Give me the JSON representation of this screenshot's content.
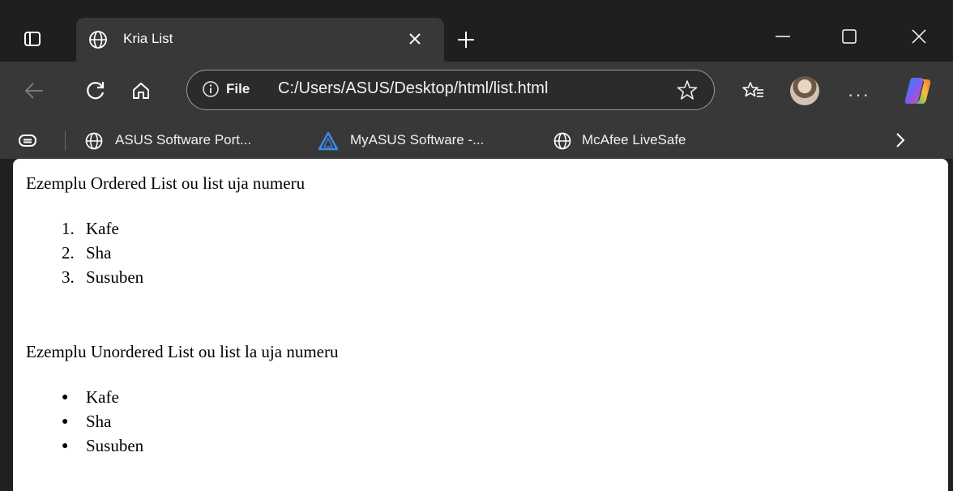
{
  "tab": {
    "title": "Kria List"
  },
  "omnibox": {
    "scheme": "File",
    "url": "C:/Users/ASUS/Desktop/html/list.html"
  },
  "favorites": [
    {
      "label": "ASUS Software Port...",
      "icon": "globe-icon"
    },
    {
      "label": "MyASUS Software -...",
      "icon": "myasus-logo-icon"
    },
    {
      "label": "McAfee LiveSafe",
      "icon": "globe-icon"
    }
  ],
  "page": {
    "ordered_heading": "Ezemplu Ordered List ou list uja numeru",
    "ordered_items": [
      {
        "marker": "1.",
        "text": "Kafe"
      },
      {
        "marker": "2.",
        "text": "Sha"
      },
      {
        "marker": "3.",
        "text": "Susuben"
      }
    ],
    "unordered_heading": "Ezemplu Unordered List ou list la uja numeru",
    "unordered_items": [
      {
        "marker": "●",
        "text": "Kafe"
      },
      {
        "marker": "●",
        "text": "Sha"
      },
      {
        "marker": "●",
        "text": "Susuben"
      }
    ]
  },
  "colors": {
    "chrome_dark": "#1f1f1f",
    "toolbar": "#383838",
    "page_bg": "#ffffff"
  }
}
